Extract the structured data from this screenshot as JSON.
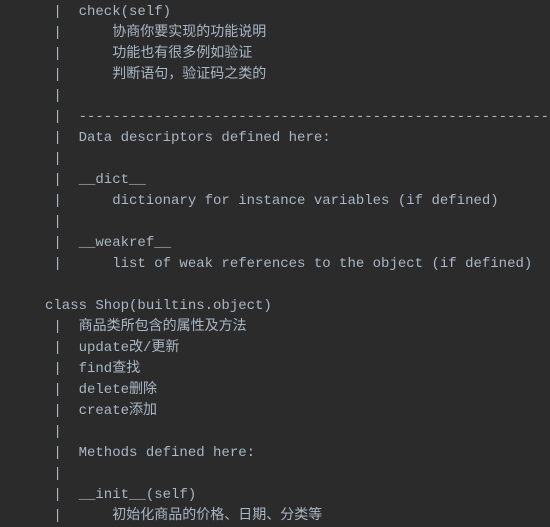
{
  "lines": [
    " |  check(self)",
    " |      协商你要实现的功能说明",
    " |      功能也有很多例如验证",
    " |      判断语句，验证码之类的",
    " |  ",
    " |  ----------------------------------------------------------",
    " |  Data descriptors defined here:",
    " |  ",
    " |  __dict__",
    " |      dictionary for instance variables (if defined)",
    " |  ",
    " |  __weakref__",
    " |      list of weak references to the object (if defined)",
    "",
    "class Shop(builtins.object)",
    " |  商品类所包含的属性及方法",
    " |  update改/更新",
    " |  find查找",
    " |  delete删除",
    " |  create添加",
    " |  ",
    " |  Methods defined here:",
    " |  ",
    " |  __init__(self)",
    " |      初始化商品的价格、日期、分类等"
  ]
}
